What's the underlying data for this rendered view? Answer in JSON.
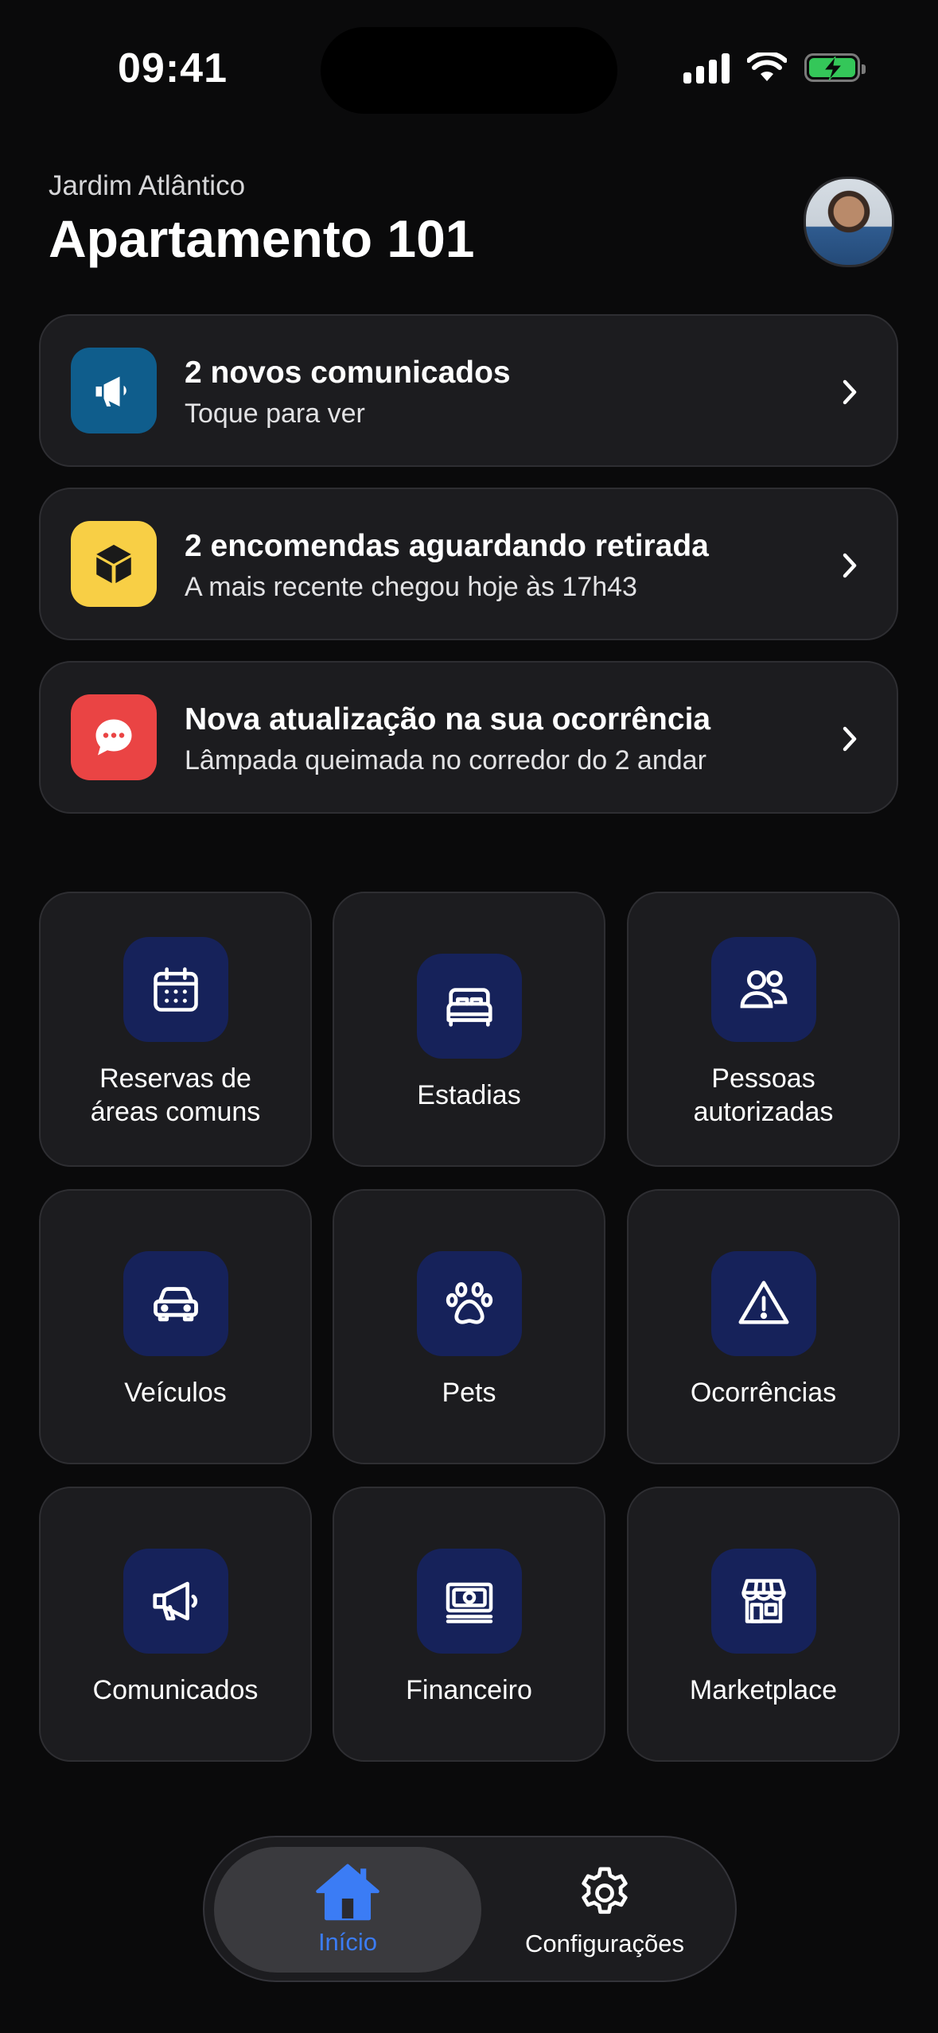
{
  "status_bar": {
    "time": "09:41"
  },
  "header": {
    "condominium": "Jardim Atlântico",
    "unit": "Apartamento 101"
  },
  "notifications": [
    {
      "title": "2 novos comunicados",
      "subtitle": "Toque para ver",
      "icon": "megaphone-icon",
      "color": "#0f5d8c"
    },
    {
      "title": "2 encomendas aguardando retirada",
      "subtitle": "A mais recente chegou hoje às 17h43",
      "icon": "package-icon",
      "color": "#f8cf45"
    },
    {
      "title": "Nova atualização na sua ocorrência",
      "subtitle": "Lâmpada queimada no corredor do 2 andar",
      "icon": "chat-bubble-icon",
      "color": "#ea4444"
    }
  ],
  "tiles": [
    {
      "label_line1": "Reservas de",
      "label_line2": "áreas comuns",
      "icon": "calendar-icon"
    },
    {
      "label_line1": "Estadias",
      "label_line2": "",
      "icon": "bed-icon"
    },
    {
      "label_line1": "Pessoas",
      "label_line2": "autorizadas",
      "icon": "people-icon"
    },
    {
      "label_line1": "Veículos",
      "label_line2": "",
      "icon": "car-icon"
    },
    {
      "label_line1": "Pets",
      "label_line2": "",
      "icon": "paw-icon"
    },
    {
      "label_line1": "Ocorrências",
      "label_line2": "",
      "icon": "warning-icon"
    },
    {
      "label_line1": "Comunicados",
      "label_line2": "",
      "icon": "megaphone-icon"
    },
    {
      "label_line1": "Financeiro",
      "label_line2": "",
      "icon": "money-icon"
    },
    {
      "label_line1": "Marketplace",
      "label_line2": "",
      "icon": "store-icon"
    }
  ],
  "bottom_nav": {
    "home_label": "Início",
    "settings_label": "Configurações",
    "active_color": "#3b7cf5",
    "tile_icon_bg": "#16225a"
  }
}
